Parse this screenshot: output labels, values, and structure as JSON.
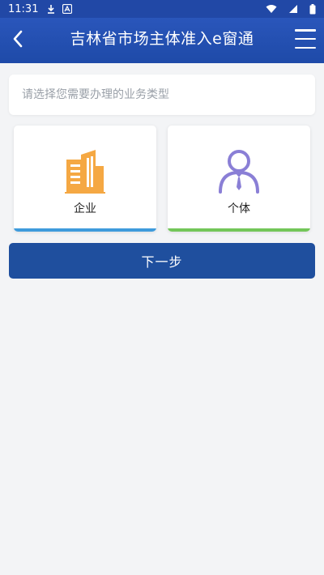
{
  "status_bar": {
    "time": "11:31",
    "icons": [
      "download-icon",
      "a-notification-icon",
      "wifi-icon",
      "signal-icon",
      "battery-icon"
    ]
  },
  "header": {
    "title": "吉林省市场主体准入e窗通",
    "back_icon": "chevron-left-icon",
    "menu_icon": "hamburger-menu-icon"
  },
  "search": {
    "placeholder": "请选择您需要办理的业务类型",
    "value": ""
  },
  "options": [
    {
      "label": "企业",
      "icon": "building-icon",
      "icon_color": "#f5a843",
      "bar_color": "#3e9bdc"
    },
    {
      "label": "个体",
      "icon": "person-icon",
      "icon_color": "#8a7fd6",
      "bar_color": "#73c659"
    }
  ],
  "next_button": {
    "label": "下一步"
  },
  "colors": {
    "header_bg": "#2148a6",
    "button_bg": "#1f4f9e",
    "page_bg": "#f3f4f6"
  }
}
